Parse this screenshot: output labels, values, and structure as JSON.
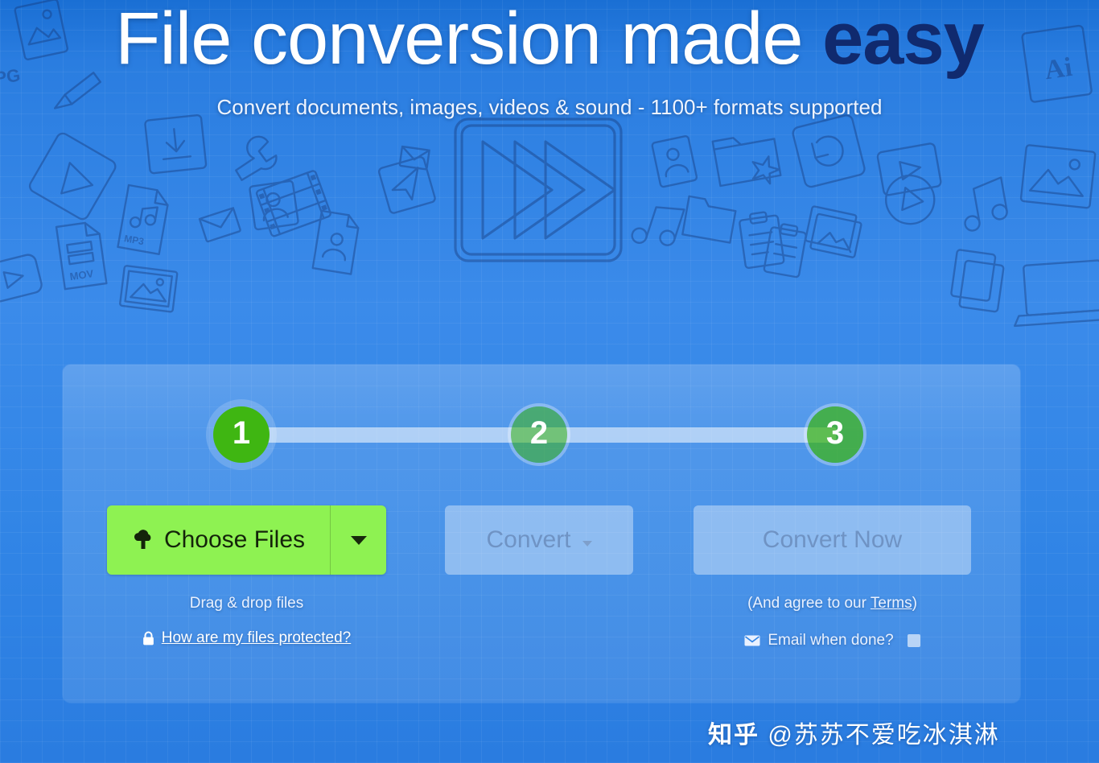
{
  "hero": {
    "headline_main": "File conversion made ",
    "headline_accent": "easy",
    "subhead": "Convert documents, images, videos & sound - 1100+ formats supported"
  },
  "stepper": {
    "steps": [
      {
        "number": "1",
        "state": "active"
      },
      {
        "number": "2",
        "state": "inactive"
      },
      {
        "number": "3",
        "state": "inactive"
      }
    ]
  },
  "actions": {
    "choose_files_label": "Choose Files",
    "choose_files_icon": "cloud-upload-icon",
    "choose_files_caret_icon": "chevron-down-icon",
    "convert_label": "Convert",
    "convert_caret_icon": "chevron-down-icon",
    "convert_now_label": "Convert Now"
  },
  "captions": {
    "drag_drop": "Drag & drop files",
    "protect_icon": "lock-icon",
    "protect_link": "How are my files protected?",
    "agree_prefix": "(And agree to our ",
    "agree_link": "Terms",
    "agree_suffix": ")",
    "email_icon": "envelope-icon",
    "email_label": "Email when done?"
  },
  "watermark": {
    "site": "知乎",
    "handle": "@苏苏不爱吃冰淇淋"
  },
  "colors": {
    "background_blue": "#3185e6",
    "accent_navy": "#102a6e",
    "green_primary": "#3fb612",
    "choose_files_green": "#8ef252",
    "ghost_button": "rgba(255,255,255,.38)",
    "ghost_text": "#6f93c4"
  }
}
